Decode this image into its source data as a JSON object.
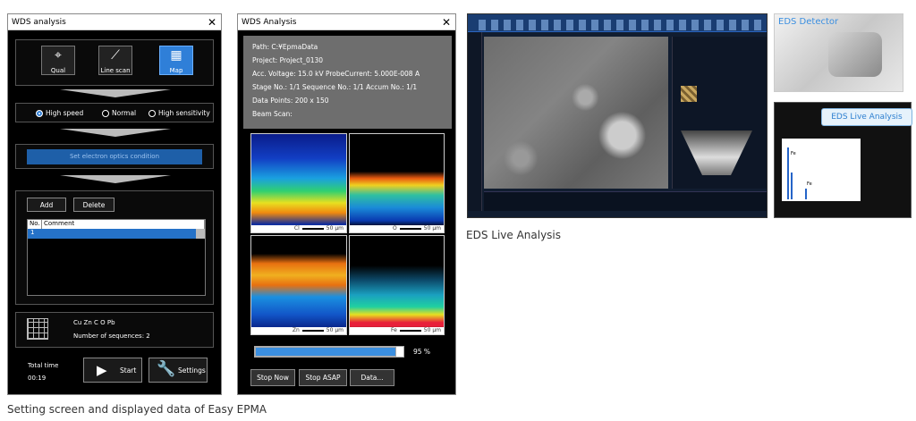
{
  "wds1": {
    "title": "WDS analysis",
    "modes": [
      {
        "label": "Qual",
        "icon": "qual-icon",
        "active": false
      },
      {
        "label": "Line scan",
        "icon": "line-scan-icon",
        "active": false
      },
      {
        "label": "Map",
        "icon": "map-icon",
        "active": true
      }
    ],
    "speed_options": [
      "High speed",
      "Normal",
      "High sensitivity"
    ],
    "selected_speed": "High speed",
    "set_condition_label": "Set electron optics condition",
    "add_label": "Add",
    "delete_label": "Delete",
    "table": {
      "headers": [
        "No.",
        "Comment"
      ],
      "rows": [
        {
          "no": "1",
          "comment": ""
        }
      ]
    },
    "elements": "Cu Zn C O Pb",
    "sequences": "Number of sequences: 2",
    "total_time_label": "Total time",
    "total_time": "00:19",
    "start_label": "Start",
    "settings_label": "Settings"
  },
  "wds2": {
    "title": "WDS Analysis",
    "info": [
      "Path: C:¥EpmaData",
      "Project: Project_0130",
      "Acc. Voltage: 15.0 kV  ProbeCurrent: 5.000E-008 A",
      "Stage No.: 1/1  Sequence No.: 1/1  Accum No.: 1/1",
      "Data Points: 200 x 150",
      "Beam Scan:"
    ],
    "maps": [
      {
        "element": "Cl",
        "scale": "50 µm"
      },
      {
        "element": "O",
        "scale": "50 µm"
      },
      {
        "element": "Zn",
        "scale": "50 µm"
      },
      {
        "element": "Fe",
        "scale": "50 µm"
      }
    ],
    "progress": 0.95,
    "progress_label": "95 %",
    "buttons": [
      "Stop Now",
      "Stop ASAP",
      "Data..."
    ]
  },
  "eds": {
    "detector_label": "EDS Detector",
    "live_label": "EDS Live Analysis",
    "spectrum_peaks": [
      "Fe",
      "Fe"
    ]
  },
  "captions": {
    "eds": "EDS Live Analysis",
    "main": "Setting screen and displayed data of Easy EPMA"
  }
}
